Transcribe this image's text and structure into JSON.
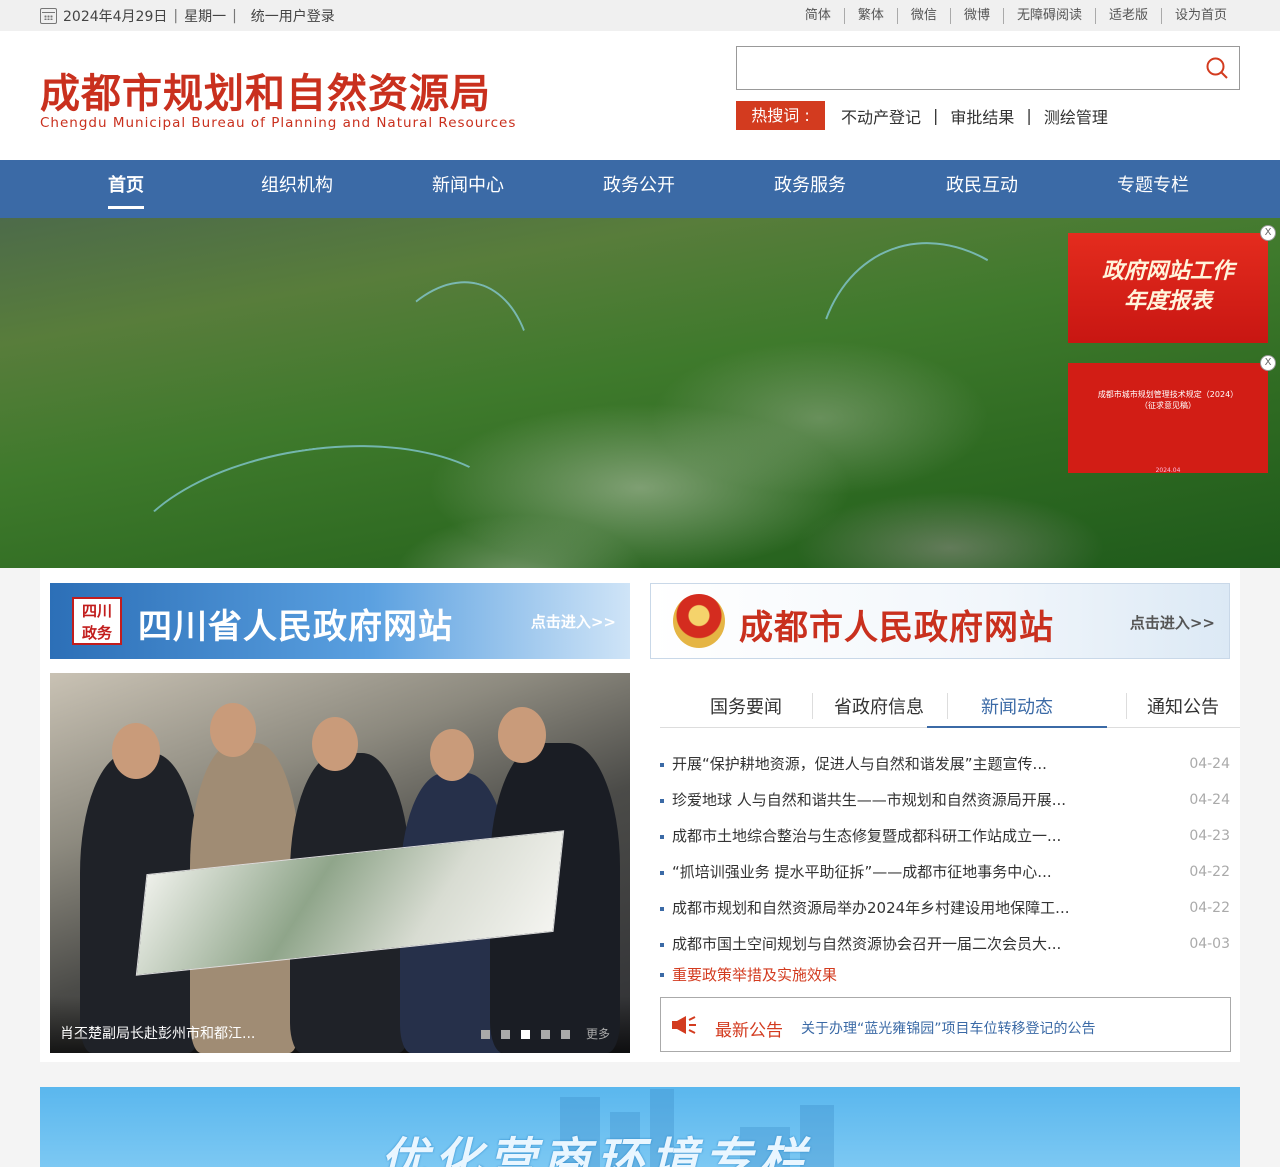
{
  "topbar": {
    "date": "2024年4月29日",
    "weekday": "星期一",
    "login": "统一用户登录",
    "links": [
      "简体",
      "繁体",
      "微信",
      "微博",
      "无障碍阅读",
      "适老版",
      "设为首页"
    ]
  },
  "header": {
    "title": "成都市规划和自然资源局",
    "subtitle": "Chengdu Municipal Bureau of Planning and Natural Resources",
    "search": {
      "value": "",
      "placeholder": ""
    },
    "hot_label": "热搜词 :",
    "hot_words": [
      "不动产登记",
      "审批结果",
      "测绘管理"
    ]
  },
  "nav": [
    "首页",
    "组织机构",
    "新闻中心",
    "政务公开",
    "政务服务",
    "政民互动",
    "专题专栏"
  ],
  "banner": {
    "ad1_line1": "政府网站工作",
    "ad1_line2": "年度报表",
    "ad2_line1": "成都市城市规划管理技术规定（2024）",
    "ad2_line2": "（征求意见稿）",
    "ad2_date": "2024.04",
    "close": "X"
  },
  "portals": {
    "sichuan": {
      "emblem": "四川政务",
      "title": "四川省人民政府网站",
      "enter": "点击进入>>"
    },
    "chengdu": {
      "title": "成都市人民政府网站",
      "enter": "点击进入>>"
    }
  },
  "slideshow": {
    "caption": "肖丕楚副局长赴彭州市和都江...",
    "more": "更多",
    "total": 5,
    "current": 3
  },
  "tabs": [
    "国务要闻",
    "省政府信息",
    "新闻动态",
    "通知公告"
  ],
  "active_tab": "新闻动态",
  "news": [
    {
      "title": "开展“保护耕地资源，促进人与自然和谐发展”主题宣传...",
      "date": "04-24"
    },
    {
      "title": "珍爱地球 人与自然和谐共生——市规划和自然资源局开展...",
      "date": "04-24"
    },
    {
      "title": "成都市土地综合整治与生态修复暨成都科研工作站成立一...",
      "date": "04-23"
    },
    {
      "title": "“抓培训强业务 提水平助征拆”——成都市征地事务中心...",
      "date": "04-22"
    },
    {
      "title": "成都市规划和自然资源局举办2024年乡村建设用地保障工...",
      "date": "04-22"
    },
    {
      "title": "成都市国土空间规划与自然资源协会召开一届二次会员大...",
      "date": "04-03"
    }
  ],
  "policy_link": "重要政策举措及实施效果",
  "notice": {
    "label": "最新公告",
    "text": "关于办理“蓝光雍锦园”项目车位转移登记的公告"
  },
  "promo": {
    "title": "优化营商环境专栏"
  },
  "colors": {
    "brand_red": "#c9301e",
    "nav_blue": "#3b6aa6"
  }
}
